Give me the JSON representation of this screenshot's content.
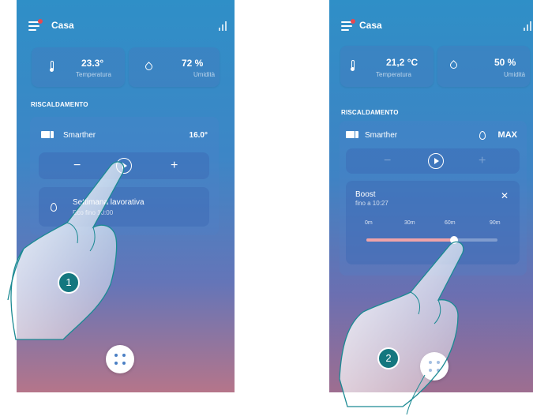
{
  "screen1": {
    "header": {
      "title": "Casa"
    },
    "temperature": {
      "value": "23.3°",
      "label": "Temperatura"
    },
    "humidity": {
      "value": "72 %",
      "label": "Umidità"
    },
    "section_title": "RISCALDAMENTO",
    "device": {
      "name": "Smarther",
      "value": "16.0°"
    },
    "controls": {
      "minus": "−",
      "plus": "+"
    },
    "schedule": {
      "title": "Settimana lavorativa",
      "subtitle": "Eco fino 10:00"
    },
    "step_number": "1"
  },
  "screen2": {
    "header": {
      "title": "Casa"
    },
    "temperature": {
      "value": "21,2 °C",
      "label": "Temperatura"
    },
    "humidity": {
      "value": "50 %",
      "label": "Umidità"
    },
    "section_title": "RISCALDAMENTO",
    "device": {
      "name": "Smarther",
      "value": "MAX"
    },
    "controls": {
      "minus": "−",
      "plus": "+"
    },
    "boost": {
      "title": "Boost",
      "subtitle": "fino a 10:27",
      "close": "✕",
      "ticks": [
        "0m",
        "30m",
        "60m",
        "90m"
      ],
      "slider_value_fraction": 0.67
    },
    "step_number": "2"
  },
  "colors": {
    "accent_red": "#e8484f",
    "step_badge": "#14777f",
    "slider_fill": "#f0a3a8"
  }
}
